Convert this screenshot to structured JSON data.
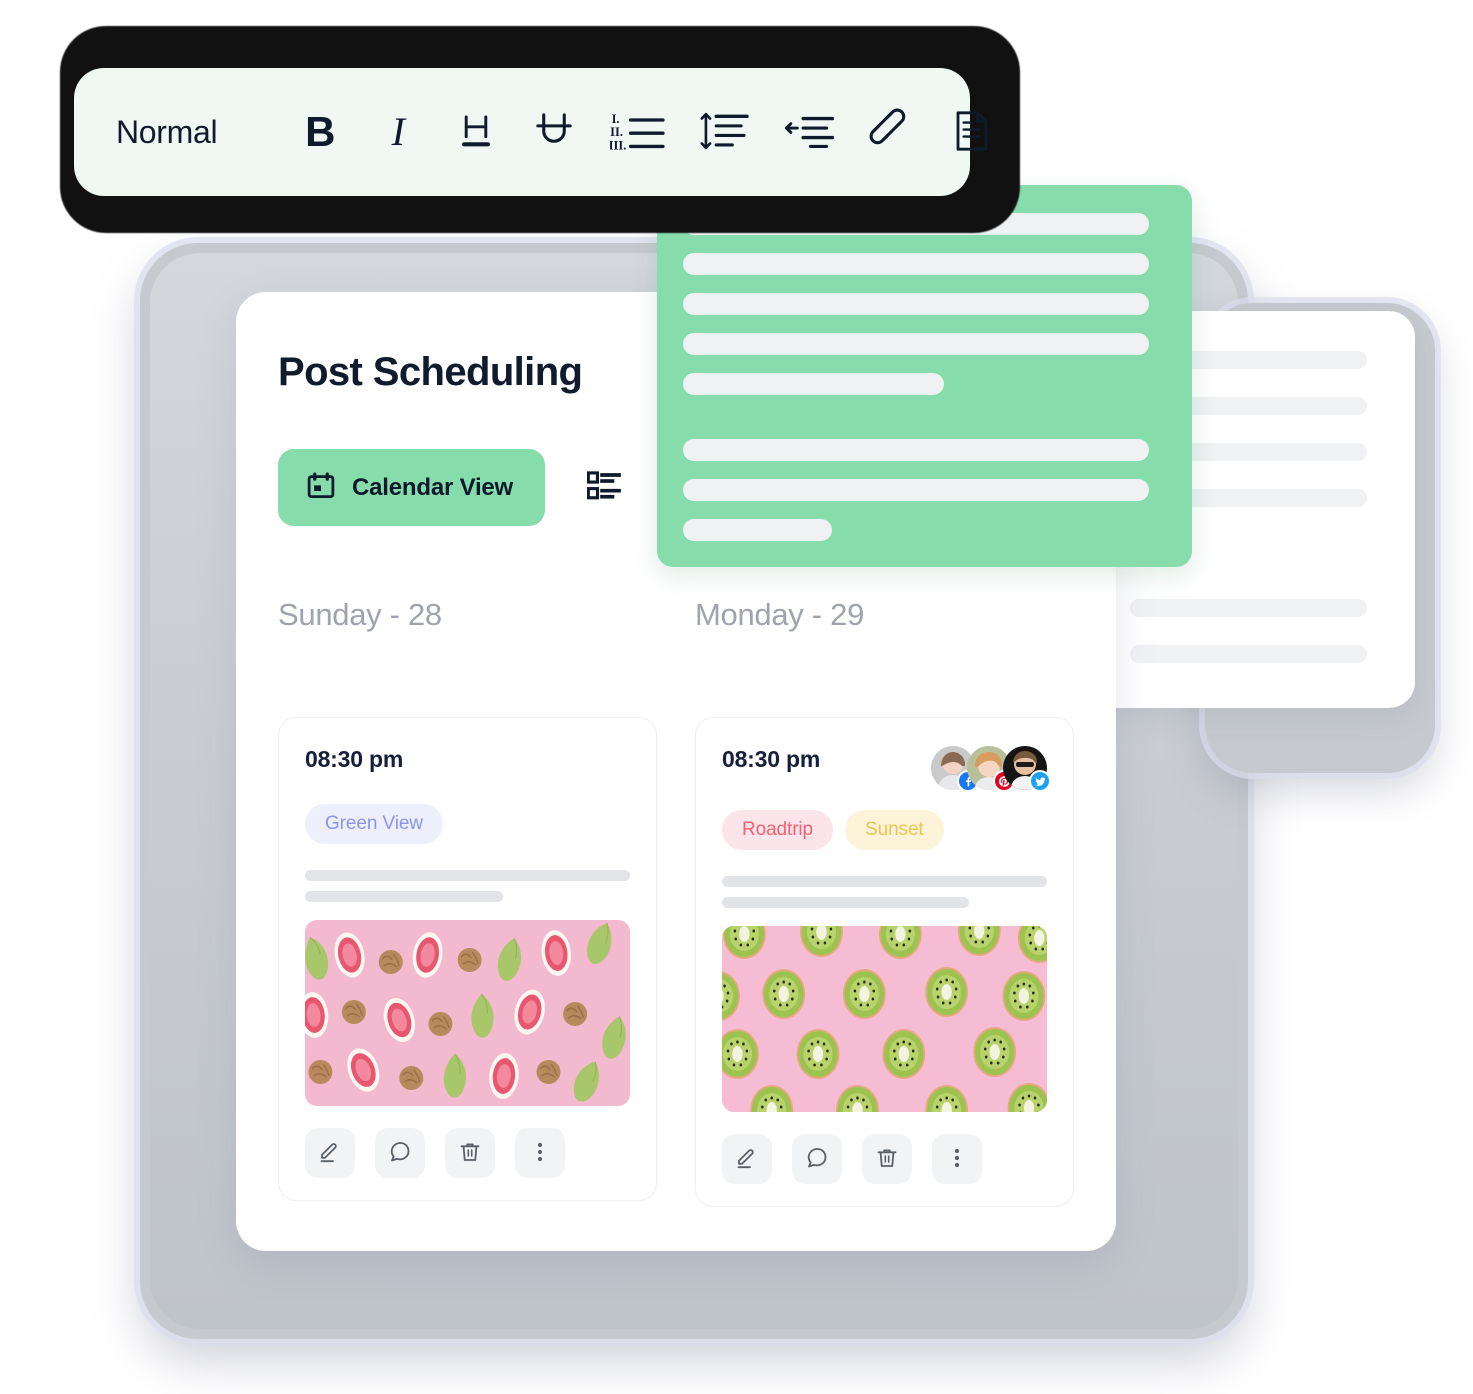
{
  "toolbar": {
    "style_label": "Normal",
    "buttons": [
      {
        "name": "bold",
        "glyph": "B"
      },
      {
        "name": "italic",
        "glyph": "I"
      },
      {
        "name": "heading",
        "glyph": "H"
      },
      {
        "name": "underline",
        "glyph": "U"
      },
      {
        "name": "ordered-list",
        "glyph": "list"
      },
      {
        "name": "line-height",
        "glyph": "line-height"
      },
      {
        "name": "outdent",
        "glyph": "outdent"
      },
      {
        "name": "link",
        "glyph": "link"
      },
      {
        "name": "document",
        "glyph": "document"
      }
    ]
  },
  "panel": {
    "title": "Post Scheduling",
    "calendar_view_label": "Calendar View",
    "list_view_label": "List View"
  },
  "days": [
    {
      "label": "Sunday - 28"
    },
    {
      "label": "Monday - 29"
    }
  ],
  "posts": [
    {
      "time": "08:30 pm",
      "tags": [
        {
          "label": "Green View",
          "bg": "#eeeffc",
          "fg": "#8b93ee"
        }
      ],
      "avatars": [],
      "image_alt": "figs-and-walnuts-on-pink",
      "actions": [
        "edit",
        "comment",
        "delete",
        "more"
      ]
    },
    {
      "time": "08:30 pm",
      "tags": [
        {
          "label": "Roadtrip",
          "bg": "#fce5ea",
          "fg": "#f4606f"
        },
        {
          "label": "Sunset",
          "bg": "#fdf3d8",
          "fg": "#edc452"
        }
      ],
      "avatars": [
        {
          "network": "facebook",
          "color": "#1877f2"
        },
        {
          "network": "pinterest",
          "color": "#e60023"
        },
        {
          "network": "twitter",
          "color": "#1da1f2"
        }
      ],
      "image_alt": "kiwi-slices-on-pink",
      "actions": [
        "edit",
        "comment",
        "delete",
        "more"
      ]
    }
  ],
  "green_card": {
    "lines": [
      {
        "width": "w100"
      },
      {
        "width": "w100"
      },
      {
        "width": "w100"
      },
      {
        "width": "w100"
      },
      {
        "width": "w56",
        "spacer": true
      },
      {
        "width": "w100"
      },
      {
        "width": "w100"
      },
      {
        "width": "w32"
      }
    ]
  },
  "right_card": {
    "lines": [
      {
        "gap": false
      },
      {
        "gap": false
      },
      {
        "gap": false
      },
      {
        "gap": true
      },
      {
        "gap": false
      },
      {
        "gap": false
      }
    ]
  },
  "colors": {
    "accent_green": "#87dcab",
    "toolbar_bg": "#eff8f2",
    "title_dark": "#111b2e",
    "day_grey": "#9ea3ad",
    "frame_grey": "#c6c9cf"
  }
}
